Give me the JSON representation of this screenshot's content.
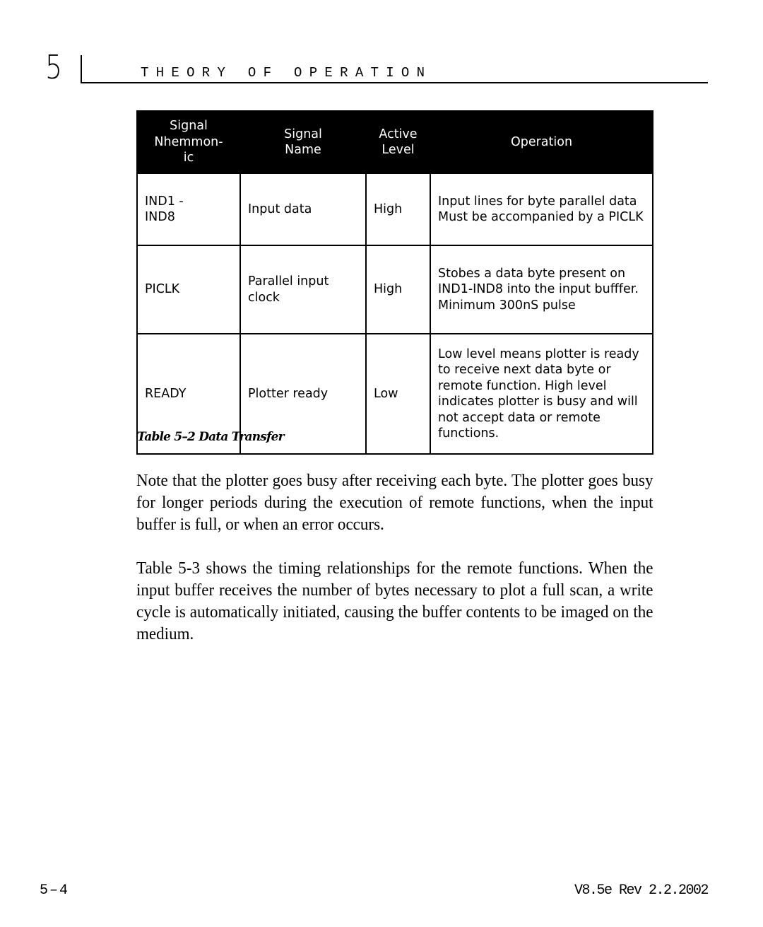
{
  "header": {
    "chapter_number": "5",
    "chapter_title": "THEORY OF OPERATION"
  },
  "table": {
    "columns": [
      "Signal Nhemmon-ic",
      "Signal Name",
      "Active Level",
      "Operation"
    ],
    "column_lines": [
      [
        "Signal",
        "Nhemmon-",
        "ic"
      ],
      [
        "Signal",
        "Name"
      ],
      [
        "Active",
        "Level"
      ],
      [
        "Operation"
      ]
    ],
    "rows": [
      {
        "mnemonic": "IND1 - IND8",
        "name": "Input data",
        "level": "High",
        "operation": "Input lines for byte parallel data Must be accompanied by a PICLK"
      },
      {
        "mnemonic": "PICLK",
        "name": "Parallel input clock",
        "level": "High",
        "operation": "Stobes a data byte present on IND1-IND8 into the input bufffer. Minimum 300nS pulse"
      },
      {
        "mnemonic": "READY",
        "name": "Plotter ready",
        "level": "Low",
        "operation": "Low level means plotter is ready to receive next data byte or remote function. High level indicates plotter is busy and will not accept data or remote functions."
      }
    ],
    "caption": "Table 5–2 Data Transfer"
  },
  "body": {
    "paragraphs": [
      "Note that the plotter goes busy after receiving each byte. The plotter goes busy for longer periods during the execution of remote functions,  when the input buffer is full, or when an error occurs.",
      "Table 5-3 shows the timing relationships for the remote functions. When the input buffer receives the number of bytes necessary to plot a full scan, a write cycle is automatically initiated, causing the buffer contents to be imaged on the medium."
    ]
  },
  "footer": {
    "page_number": "5–4",
    "version": "V8.5e Rev 2.2.2002"
  }
}
